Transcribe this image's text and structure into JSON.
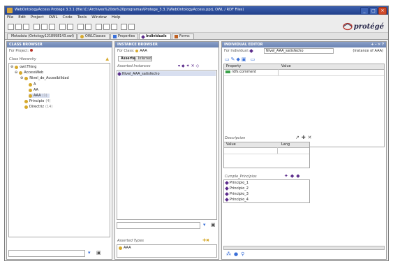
{
  "window": {
    "title": "WebOntologyAccess Protégé 3.3.1   (file:\\C:\\Archives%20de%20programas\\Protege_3.3.1\\WebOntologyAccess.pprj, OWL / RDF Files)",
    "buttons": [
      "_",
      "□",
      "✕"
    ]
  },
  "menu": [
    "File",
    "Edit",
    "Project",
    "OWL",
    "Code",
    "Tools",
    "Window",
    "Help"
  ],
  "brand": {
    "name": "protégé",
    "accent": "#2b2b4d"
  },
  "tabs": [
    {
      "label": "Metadata (Ontology1218998143.owl)",
      "icon": "#8a4ad0"
    },
    {
      "label": "OWLClasses",
      "icon": "#d6a92c"
    },
    {
      "label": "Properties",
      "icon": "#3a6fd8"
    },
    {
      "label": "Individuals",
      "icon": "#5a2a8a"
    },
    {
      "label": "Forms",
      "icon": "#c06020"
    }
  ],
  "class_browser": {
    "header": "CLASS BROWSER",
    "for_project": "For Project:",
    "hierarchy_label": "Class Hierarchy",
    "tree": [
      {
        "label": "owl:Thing",
        "level": 0
      },
      {
        "label": "AccessWeb",
        "level": 1
      },
      {
        "label": "Nivel_de_Accesibilidad",
        "level": 2
      },
      {
        "label": "A",
        "level": 3
      },
      {
        "label": "AA",
        "level": 3
      },
      {
        "label": "AAA",
        "count": "(1)",
        "level": 3,
        "selected": true
      },
      {
        "label": "Principio",
        "count": "(4)",
        "level": 2
      },
      {
        "label": "Directriz",
        "count": "(14)",
        "level": 2
      }
    ]
  },
  "instance_browser": {
    "header": "INSTANCE BROWSER",
    "for_class": "For Class:",
    "class_name": "AAA",
    "subtabs": [
      "Asserted",
      "Inferred"
    ],
    "instances_label": "Asserted Instances",
    "instances": [
      "Nivel_AAA_satisfecho"
    ],
    "types_label": "Asserted Types",
    "types": [
      "AAA"
    ]
  },
  "individual_editor": {
    "header": "INDIVIDUAL EDITOR",
    "header_icons": "+ - ✕ ?",
    "for_individual": "For Individual:",
    "individual_name": "Nivel_AAA_satisfecho",
    "instance_of": "(instance of AAA)",
    "property_col": "Property",
    "value_col": "Value",
    "properties": [
      "rdfs:comment"
    ],
    "description_label": "Descripcion",
    "desc_value_col": "Value",
    "desc_lang_col": "Lang",
    "cumple_label": "Cumple_Principios",
    "principios": [
      "Principio_1",
      "Principio_2",
      "Principio_3",
      "Principio_4"
    ]
  }
}
